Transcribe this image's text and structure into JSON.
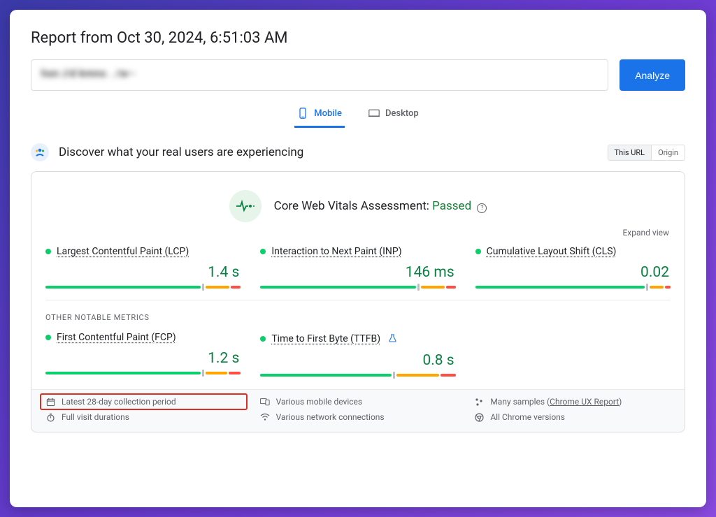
{
  "header": {
    "report_title": "Report from Oct 30, 2024, 6:51:03 AM",
    "url_blurred": "hxn //d kmns . /w--",
    "analyze_label": "Analyze"
  },
  "tabs": {
    "mobile": "Mobile",
    "desktop": "Desktop",
    "active": "mobile"
  },
  "discover": {
    "title": "Discover what your real users are experiencing",
    "this_url": "This URL",
    "origin": "Origin"
  },
  "assessment": {
    "label": "Core Web Vitals Assessment:",
    "status": "Passed",
    "expand": "Expand view"
  },
  "metrics": {
    "primary": [
      {
        "name": "Largest Contentful Paint (LCP)",
        "value": "1.4 s",
        "segs": [
          78,
          2,
          12,
          5
        ]
      },
      {
        "name": "Interaction to Next Paint (INP)",
        "value": "146 ms",
        "segs": [
          80,
          2,
          12,
          5
        ]
      },
      {
        "name": "Cumulative Layout Shift (CLS)",
        "value": "0.02",
        "segs": [
          88,
          2,
          7,
          3
        ]
      }
    ],
    "secondary_title": "OTHER NOTABLE METRICS",
    "secondary": [
      {
        "name": "First Contentful Paint (FCP)",
        "value": "1.2 s",
        "segs": [
          78,
          2,
          11,
          6
        ],
        "flask": false
      },
      {
        "name": "Time to First Byte (TTFB)",
        "value": "0.8 s",
        "segs": [
          68,
          2,
          22,
          8
        ],
        "flask": true
      }
    ]
  },
  "footer": {
    "collection": "Latest 28-day collection period",
    "devices": "Various mobile devices",
    "samples_prefix": "Many samples (",
    "samples_link": "Chrome UX Report",
    "samples_suffix": ")",
    "durations": "Full visit durations",
    "network": "Various network connections",
    "chrome": "All Chrome versions"
  }
}
